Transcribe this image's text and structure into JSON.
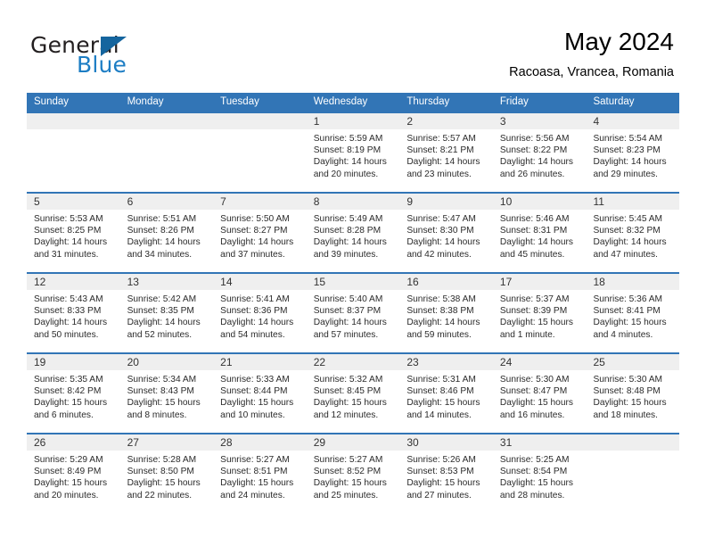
{
  "brand": {
    "name_part1": "General",
    "name_part2": "Blue",
    "flag_icon": "triangle-flag-icon",
    "accent_color": "#1d7dc4"
  },
  "header": {
    "month_title": "May 2024",
    "location": "Racoasa, Vrancea, Romania"
  },
  "calendar": {
    "header_color": "#3275b6",
    "daynumber_bg": "#efefef",
    "weekdays": [
      "Sunday",
      "Monday",
      "Tuesday",
      "Wednesday",
      "Thursday",
      "Friday",
      "Saturday"
    ],
    "weeks": [
      [
        {
          "day": "",
          "sunrise": "",
          "sunset": "",
          "daylight1": "",
          "daylight2": ""
        },
        {
          "day": "",
          "sunrise": "",
          "sunset": "",
          "daylight1": "",
          "daylight2": ""
        },
        {
          "day": "",
          "sunrise": "",
          "sunset": "",
          "daylight1": "",
          "daylight2": ""
        },
        {
          "day": "1",
          "sunrise": "Sunrise: 5:59 AM",
          "sunset": "Sunset: 8:19 PM",
          "daylight1": "Daylight: 14 hours",
          "daylight2": "and 20 minutes."
        },
        {
          "day": "2",
          "sunrise": "Sunrise: 5:57 AM",
          "sunset": "Sunset: 8:21 PM",
          "daylight1": "Daylight: 14 hours",
          "daylight2": "and 23 minutes."
        },
        {
          "day": "3",
          "sunrise": "Sunrise: 5:56 AM",
          "sunset": "Sunset: 8:22 PM",
          "daylight1": "Daylight: 14 hours",
          "daylight2": "and 26 minutes."
        },
        {
          "day": "4",
          "sunrise": "Sunrise: 5:54 AM",
          "sunset": "Sunset: 8:23 PM",
          "daylight1": "Daylight: 14 hours",
          "daylight2": "and 29 minutes."
        }
      ],
      [
        {
          "day": "5",
          "sunrise": "Sunrise: 5:53 AM",
          "sunset": "Sunset: 8:25 PM",
          "daylight1": "Daylight: 14 hours",
          "daylight2": "and 31 minutes."
        },
        {
          "day": "6",
          "sunrise": "Sunrise: 5:51 AM",
          "sunset": "Sunset: 8:26 PM",
          "daylight1": "Daylight: 14 hours",
          "daylight2": "and 34 minutes."
        },
        {
          "day": "7",
          "sunrise": "Sunrise: 5:50 AM",
          "sunset": "Sunset: 8:27 PM",
          "daylight1": "Daylight: 14 hours",
          "daylight2": "and 37 minutes."
        },
        {
          "day": "8",
          "sunrise": "Sunrise: 5:49 AM",
          "sunset": "Sunset: 8:28 PM",
          "daylight1": "Daylight: 14 hours",
          "daylight2": "and 39 minutes."
        },
        {
          "day": "9",
          "sunrise": "Sunrise: 5:47 AM",
          "sunset": "Sunset: 8:30 PM",
          "daylight1": "Daylight: 14 hours",
          "daylight2": "and 42 minutes."
        },
        {
          "day": "10",
          "sunrise": "Sunrise: 5:46 AM",
          "sunset": "Sunset: 8:31 PM",
          "daylight1": "Daylight: 14 hours",
          "daylight2": "and 45 minutes."
        },
        {
          "day": "11",
          "sunrise": "Sunrise: 5:45 AM",
          "sunset": "Sunset: 8:32 PM",
          "daylight1": "Daylight: 14 hours",
          "daylight2": "and 47 minutes."
        }
      ],
      [
        {
          "day": "12",
          "sunrise": "Sunrise: 5:43 AM",
          "sunset": "Sunset: 8:33 PM",
          "daylight1": "Daylight: 14 hours",
          "daylight2": "and 50 minutes."
        },
        {
          "day": "13",
          "sunrise": "Sunrise: 5:42 AM",
          "sunset": "Sunset: 8:35 PM",
          "daylight1": "Daylight: 14 hours",
          "daylight2": "and 52 minutes."
        },
        {
          "day": "14",
          "sunrise": "Sunrise: 5:41 AM",
          "sunset": "Sunset: 8:36 PM",
          "daylight1": "Daylight: 14 hours",
          "daylight2": "and 54 minutes."
        },
        {
          "day": "15",
          "sunrise": "Sunrise: 5:40 AM",
          "sunset": "Sunset: 8:37 PM",
          "daylight1": "Daylight: 14 hours",
          "daylight2": "and 57 minutes."
        },
        {
          "day": "16",
          "sunrise": "Sunrise: 5:38 AM",
          "sunset": "Sunset: 8:38 PM",
          "daylight1": "Daylight: 14 hours",
          "daylight2": "and 59 minutes."
        },
        {
          "day": "17",
          "sunrise": "Sunrise: 5:37 AM",
          "sunset": "Sunset: 8:39 PM",
          "daylight1": "Daylight: 15 hours",
          "daylight2": "and 1 minute."
        },
        {
          "day": "18",
          "sunrise": "Sunrise: 5:36 AM",
          "sunset": "Sunset: 8:41 PM",
          "daylight1": "Daylight: 15 hours",
          "daylight2": "and 4 minutes."
        }
      ],
      [
        {
          "day": "19",
          "sunrise": "Sunrise: 5:35 AM",
          "sunset": "Sunset: 8:42 PM",
          "daylight1": "Daylight: 15 hours",
          "daylight2": "and 6 minutes."
        },
        {
          "day": "20",
          "sunrise": "Sunrise: 5:34 AM",
          "sunset": "Sunset: 8:43 PM",
          "daylight1": "Daylight: 15 hours",
          "daylight2": "and 8 minutes."
        },
        {
          "day": "21",
          "sunrise": "Sunrise: 5:33 AM",
          "sunset": "Sunset: 8:44 PM",
          "daylight1": "Daylight: 15 hours",
          "daylight2": "and 10 minutes."
        },
        {
          "day": "22",
          "sunrise": "Sunrise: 5:32 AM",
          "sunset": "Sunset: 8:45 PM",
          "daylight1": "Daylight: 15 hours",
          "daylight2": "and 12 minutes."
        },
        {
          "day": "23",
          "sunrise": "Sunrise: 5:31 AM",
          "sunset": "Sunset: 8:46 PM",
          "daylight1": "Daylight: 15 hours",
          "daylight2": "and 14 minutes."
        },
        {
          "day": "24",
          "sunrise": "Sunrise: 5:30 AM",
          "sunset": "Sunset: 8:47 PM",
          "daylight1": "Daylight: 15 hours",
          "daylight2": "and 16 minutes."
        },
        {
          "day": "25",
          "sunrise": "Sunrise: 5:30 AM",
          "sunset": "Sunset: 8:48 PM",
          "daylight1": "Daylight: 15 hours",
          "daylight2": "and 18 minutes."
        }
      ],
      [
        {
          "day": "26",
          "sunrise": "Sunrise: 5:29 AM",
          "sunset": "Sunset: 8:49 PM",
          "daylight1": "Daylight: 15 hours",
          "daylight2": "and 20 minutes."
        },
        {
          "day": "27",
          "sunrise": "Sunrise: 5:28 AM",
          "sunset": "Sunset: 8:50 PM",
          "daylight1": "Daylight: 15 hours",
          "daylight2": "and 22 minutes."
        },
        {
          "day": "28",
          "sunrise": "Sunrise: 5:27 AM",
          "sunset": "Sunset: 8:51 PM",
          "daylight1": "Daylight: 15 hours",
          "daylight2": "and 24 minutes."
        },
        {
          "day": "29",
          "sunrise": "Sunrise: 5:27 AM",
          "sunset": "Sunset: 8:52 PM",
          "daylight1": "Daylight: 15 hours",
          "daylight2": "and 25 minutes."
        },
        {
          "day": "30",
          "sunrise": "Sunrise: 5:26 AM",
          "sunset": "Sunset: 8:53 PM",
          "daylight1": "Daylight: 15 hours",
          "daylight2": "and 27 minutes."
        },
        {
          "day": "31",
          "sunrise": "Sunrise: 5:25 AM",
          "sunset": "Sunset: 8:54 PM",
          "daylight1": "Daylight: 15 hours",
          "daylight2": "and 28 minutes."
        },
        {
          "day": "",
          "sunrise": "",
          "sunset": "",
          "daylight1": "",
          "daylight2": ""
        }
      ]
    ]
  }
}
